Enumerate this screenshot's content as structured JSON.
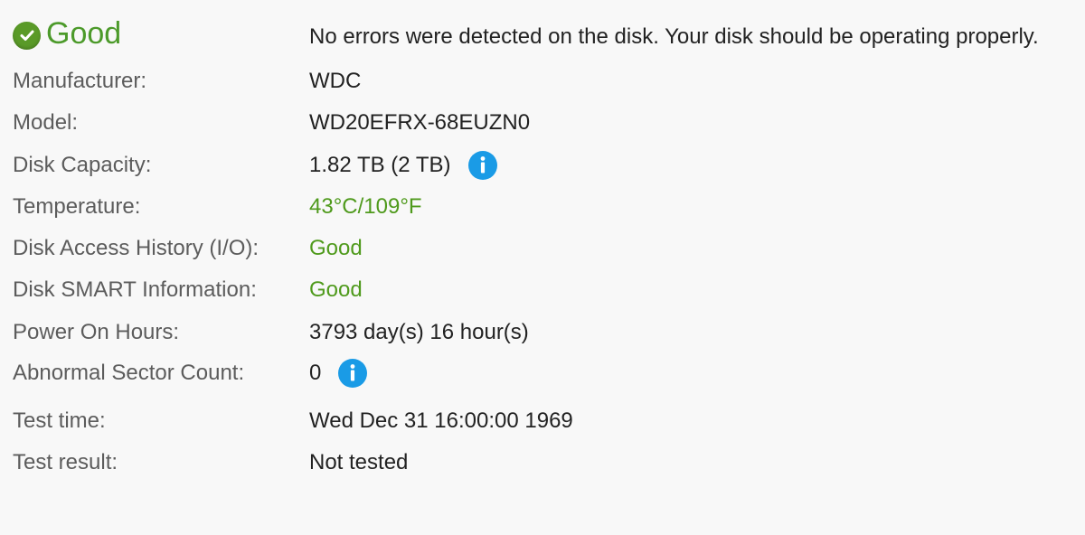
{
  "status": {
    "label": "Good",
    "message": "No errors were detected on the disk. Your disk should be operating properly.",
    "icon": "check-circle-icon",
    "color": "#4c9a2a"
  },
  "rows": [
    {
      "label": "Manufacturer:",
      "value": "WDC"
    },
    {
      "label": "Model:",
      "value": "WD20EFRX-68EUZN0"
    },
    {
      "label": "Disk Capacity:",
      "value": "1.82 TB (2 TB)",
      "icon": "info-icon"
    },
    {
      "label": "Temperature:",
      "value": "43°C/109°F",
      "color": "#4f9a1c"
    },
    {
      "label": "Disk Access History (I/O):",
      "value": "Good",
      "color": "#4f9a1c"
    },
    {
      "label": "Disk SMART Information:",
      "value": "Good",
      "color": "#4f9a1c"
    },
    {
      "label": "Power On Hours:",
      "value": "3793 day(s) 16 hour(s)"
    },
    {
      "label": "Abnormal Sector Count:",
      "value": "0",
      "icon": "info-icon"
    },
    {
      "label": "Test time:",
      "value": "Wed Dec 31 16:00:00 1969"
    },
    {
      "label": "Test result:",
      "value": "Not tested"
    }
  ],
  "colors": {
    "background": "#f8f8f8",
    "label_text": "#5c5c5c",
    "value_text": "#222222",
    "good_green": "#4f9a1c",
    "info_blue": "#1a9be6"
  }
}
